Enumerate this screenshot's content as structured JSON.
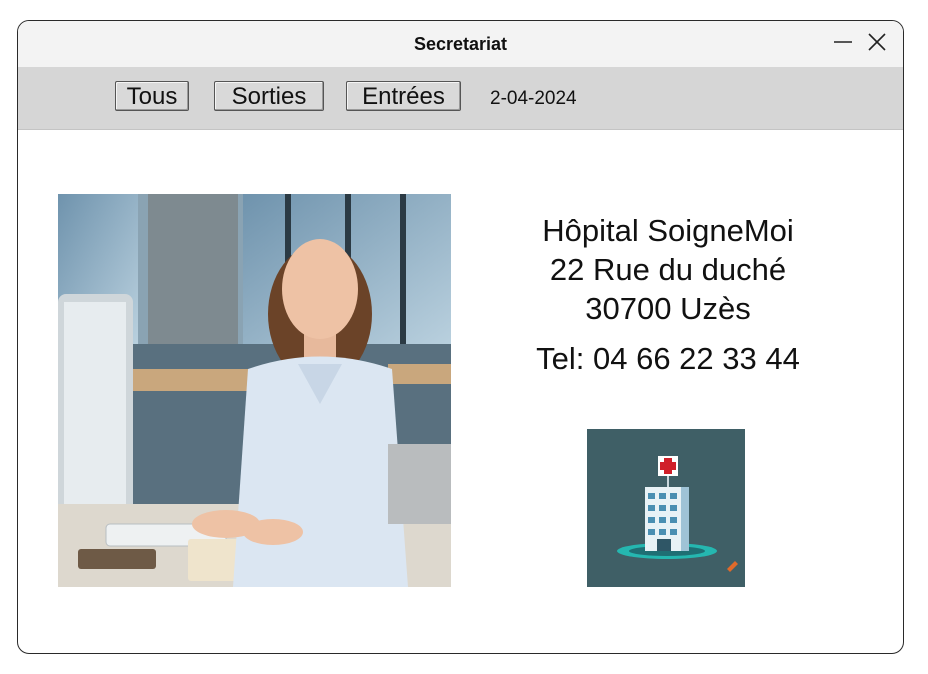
{
  "window": {
    "title": "Secretariat",
    "controls": [
      "minimize-icon",
      "close-icon"
    ]
  },
  "menu": {
    "tabs": [
      {
        "label": "Tous"
      },
      {
        "label": "Sorties"
      },
      {
        "label": "Entrées"
      }
    ],
    "date": "2-04-2024"
  },
  "hospital": {
    "name": "Hôpital SoigneMoi",
    "street": "22 Rue du duché",
    "city": "30700 Uzès",
    "tel": "Tel: 04 66 22 33 44"
  },
  "colors": {
    "menubar": "#d6d6d6",
    "logo_bg": "#3f5f66",
    "cross": "#d0202a"
  }
}
